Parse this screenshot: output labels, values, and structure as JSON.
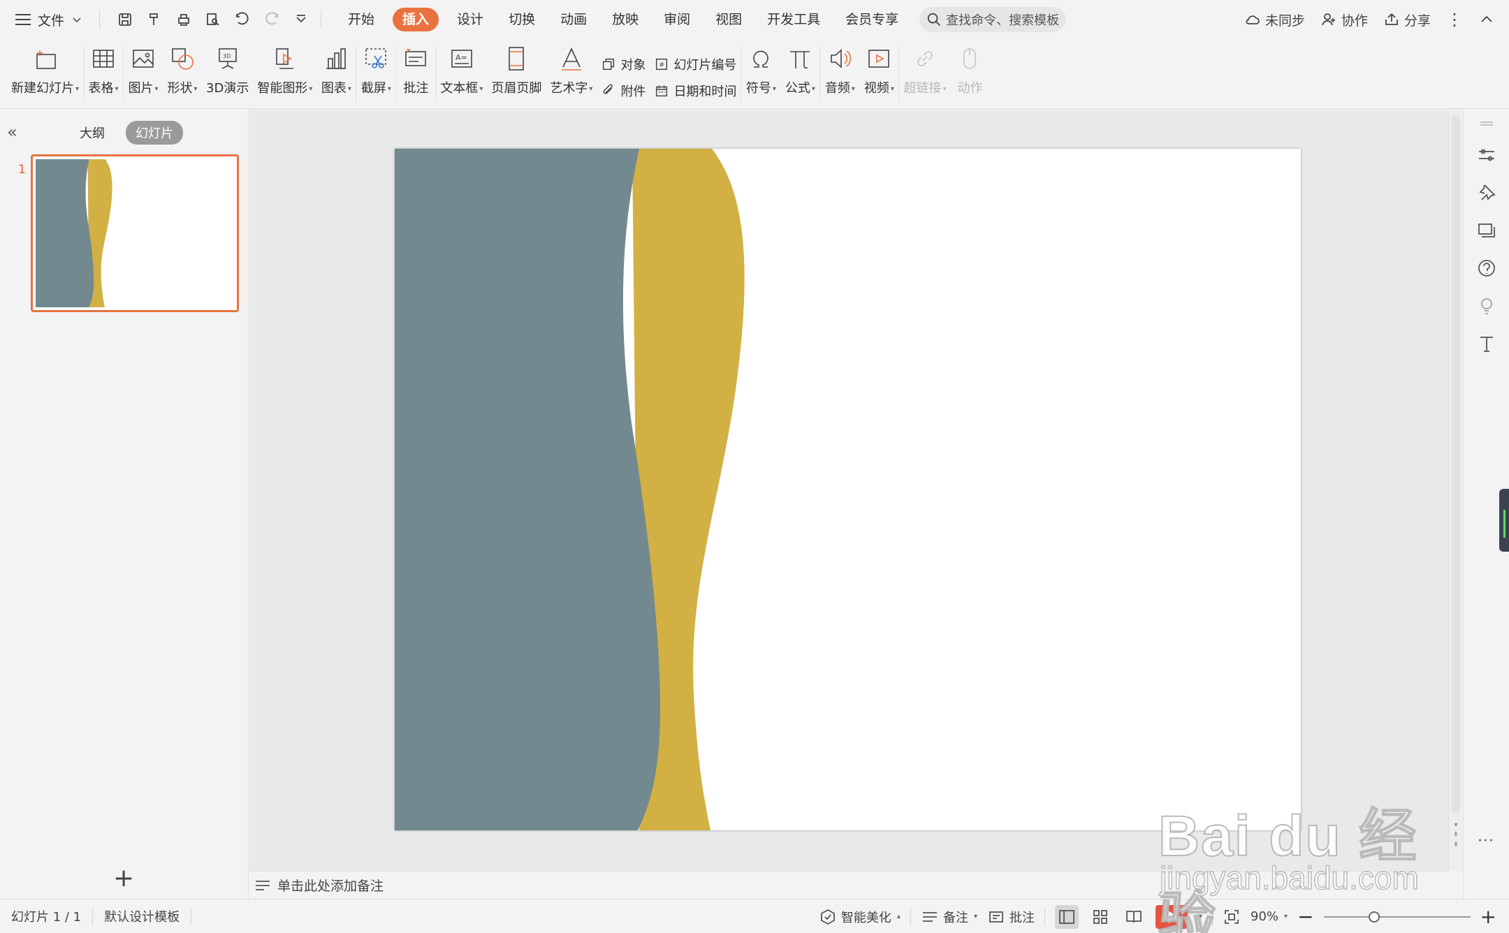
{
  "menu": {
    "file": "文件",
    "tabs": [
      "开始",
      "插入",
      "设计",
      "切换",
      "动画",
      "放映",
      "审阅",
      "视图",
      "开发工具",
      "会员专享"
    ],
    "active_tab": "插入",
    "search_placeholder": "查找命令、搜索模板",
    "sync": "未同步",
    "collab": "协作",
    "share": "分享"
  },
  "ribbon": {
    "new_slide": "新建幻灯片",
    "table": "表格",
    "picture": "图片",
    "shape": "形状",
    "demo3d": "3D演示",
    "smartart": "智能图形",
    "chart": "图表",
    "screenshot": "截屏",
    "comment": "批注",
    "textbox": "文本框",
    "header_footer": "页眉页脚",
    "wordart": "艺术字",
    "object": "对象",
    "attachment": "附件",
    "slide_number": "幻灯片编号",
    "date_time": "日期和时间",
    "symbol": "符号",
    "formula": "公式",
    "audio": "音频",
    "video": "视频",
    "hyperlink": "超链接",
    "action": "动作"
  },
  "panel": {
    "outline_tab": "大纲",
    "slides_tab": "幻灯片",
    "slide_number": "1"
  },
  "notes": {
    "placeholder": "单击此处添加备注"
  },
  "status": {
    "slide_info": "幻灯片 1 / 1",
    "template": "默认设计模板",
    "beautify": "智能美化",
    "notes": "备注",
    "comments": "批注",
    "zoom": "90%",
    "zoom_fraction": 0.33
  },
  "watermark": {
    "brand": "Bai du 经验",
    "url": "jingyan.baidu.com"
  },
  "colors": {
    "accent": "#e8733f",
    "slide_slate": "#728990",
    "slide_gold": "#d2b044"
  },
  "icons": [
    "hamburger-icon",
    "save-icon",
    "undo-icon",
    "redo-icon",
    "search-icon",
    "cloud-icon",
    "user-icon",
    "share-icon"
  ]
}
